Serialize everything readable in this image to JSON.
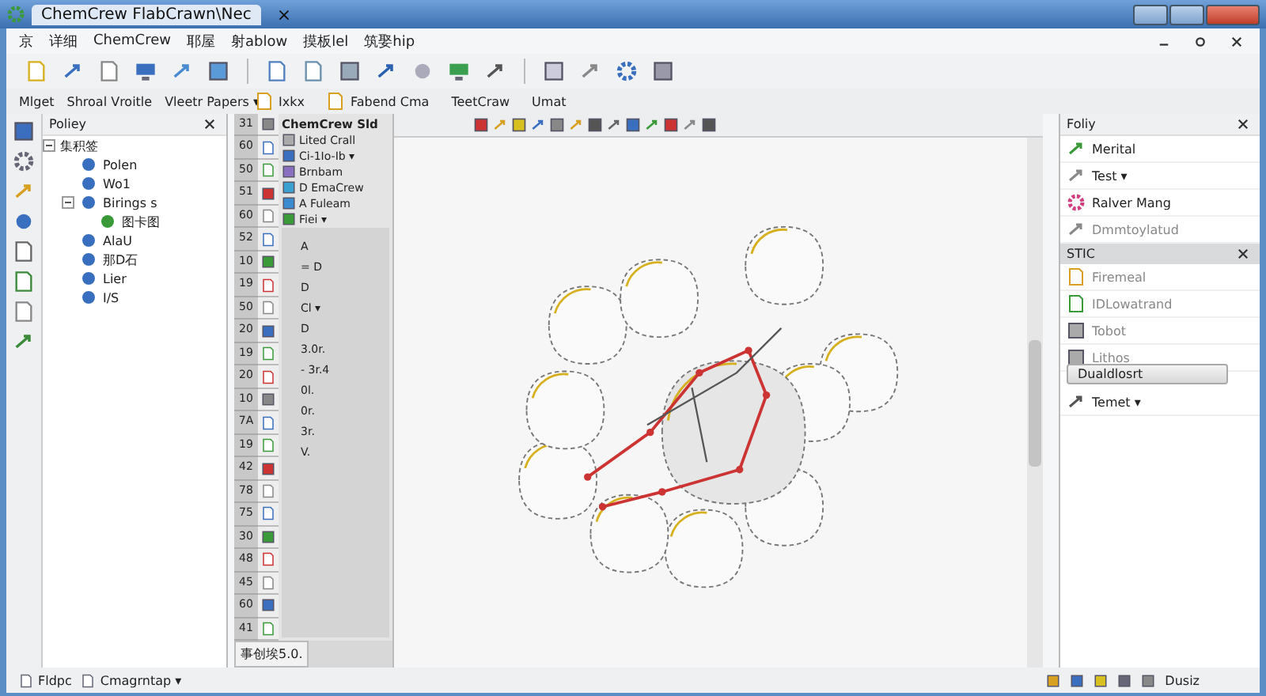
{
  "window": {
    "title": "ChemCrew FlabCrawn\\Nec",
    "tab_close": "×"
  },
  "menu": [
    "京",
    "详细",
    "ChemCrew",
    "耶屋",
    "射ablow",
    "摸板lel",
    "筑娶hip"
  ],
  "panel_bar": [
    {
      "label": "Mlget"
    },
    {
      "label": "Shroal Vroitle"
    },
    {
      "label": "Vleetr Papers ▾"
    }
  ],
  "doc_bar": [
    {
      "label": "Ixkx"
    },
    {
      "label": "Fabend Cma"
    },
    {
      "label": "TeetCraw"
    },
    {
      "label": "Umat"
    }
  ],
  "tree": {
    "title": "Poliey",
    "root": {
      "label": "集积签",
      "expanded": true,
      "children": [
        {
          "label": "Polen"
        },
        {
          "label": "Wo1"
        },
        {
          "label": "Birings s",
          "expanded": true,
          "children": [
            {
              "label": "图卡图"
            }
          ]
        },
        {
          "label": "AlaU"
        },
        {
          "label": "那D石"
        },
        {
          "label": "Lier"
        },
        {
          "label": "I/S"
        }
      ]
    }
  },
  "mid": {
    "title": "ChemCrew Sld",
    "line_numbers": [
      "31",
      "60",
      "50",
      "51",
      "60",
      "52",
      "10",
      "19",
      "50",
      "20",
      "19",
      "20",
      "10",
      "7A",
      "19",
      "42",
      "78",
      "75",
      "30",
      "48",
      "45",
      "60",
      "41"
    ],
    "items": [
      "Lited Crall",
      "Ci-1Io-Ib ▾",
      "Brnbam",
      "D EmaCrew",
      "A Fuleam",
      "Fiei ▾"
    ],
    "props": [
      "A",
      "= D",
      "D",
      "Cl ▾",
      "D",
      "3.0r.",
      "- 3r.4",
      "0l.",
      "0r.",
      "3r.",
      "V."
    ],
    "tab": "事创埃5.0."
  },
  "right": {
    "title": "Foliy",
    "rows": [
      "Merital",
      "Test ▾",
      "Ralver Mang",
      "Dmmtoylatud"
    ],
    "section": "STIC",
    "section_items": [
      "Firemeal",
      "IDLowatrand",
      "Tobot",
      "Lithos"
    ],
    "button": "Dualdlosrt",
    "footer": "Temet ▾"
  },
  "status": {
    "left": [
      "Fldpc",
      "Cmagrntap ▾"
    ],
    "right": "Dusiz"
  }
}
